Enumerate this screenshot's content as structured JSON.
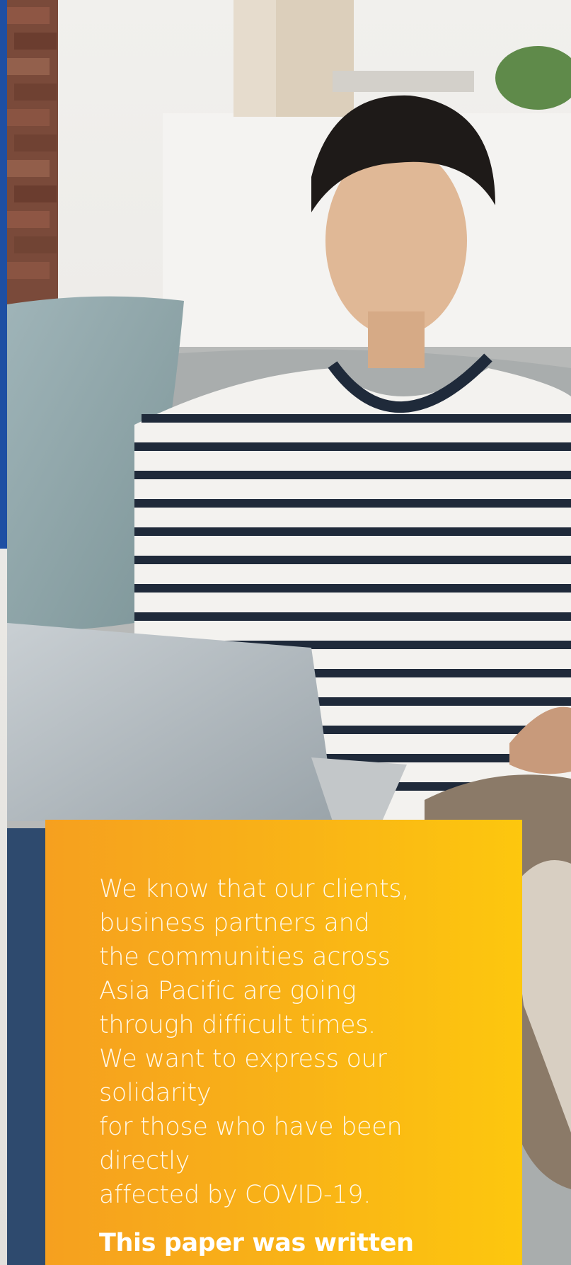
{
  "colors": {
    "accent_bar": "#1e4fa3",
    "card_gradient_start": "#f6a01f",
    "card_gradient_end": "#fdc70e",
    "text": "#ffffff"
  },
  "hero_image": {
    "icon": "person-with-laptop-photo"
  },
  "card": {
    "body_text": "We know that our clients,\nbusiness partners and\nthe communities across\nAsia Pacific are going\nthrough difficult times.\nWe want to express our solidarity\nfor those who have been directly\naffected by COVID-19.",
    "emphasis_text": "This paper was written\nin an effort to provide you\nwith key insights that"
  }
}
